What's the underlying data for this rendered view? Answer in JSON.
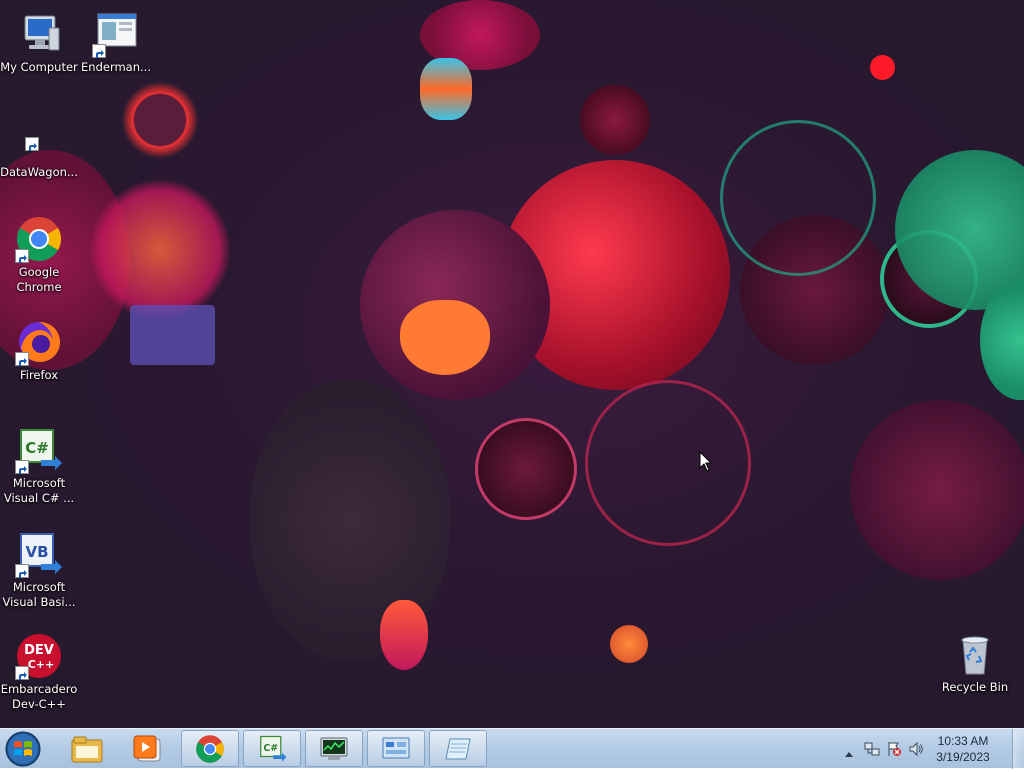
{
  "desktop": {
    "icons": [
      {
        "label": "My Computer",
        "icon": "computer-icon"
      },
      {
        "label": "Enderman...",
        "icon": "window-app-icon"
      },
      {
        "label": "DataWagon...",
        "icon": "blank-shortcut-icon"
      },
      {
        "label": "Google Chrome",
        "icon": "chrome-icon"
      },
      {
        "label": "Firefox",
        "icon": "firefox-icon"
      },
      {
        "label": "Microsoft Visual C# ...",
        "icon": "csharp-icon"
      },
      {
        "label": "Microsoft Visual Basi...",
        "icon": "vb-icon"
      },
      {
        "label": "Embarcadero Dev-C++",
        "icon": "devcpp-icon"
      },
      {
        "label": "Recycle Bin",
        "icon": "recycle-bin-icon"
      }
    ],
    "wallpaper_colors": [
      "#241a2c",
      "#c2185b",
      "#ff6f3c",
      "#26a69a",
      "#e91e63"
    ]
  },
  "taskbar": {
    "pinned": [
      {
        "icon": "file-explorer-icon"
      },
      {
        "icon": "media-player-icon"
      }
    ],
    "running": [
      {
        "icon": "chrome-icon"
      },
      {
        "icon": "csharp-icon"
      },
      {
        "icon": "task-manager-icon"
      },
      {
        "icon": "control-panel-icon"
      },
      {
        "icon": "notepad-icon"
      }
    ],
    "tray": {
      "icons": [
        "show-hidden-icons-arrow",
        "network-icon",
        "action-center-flag-icon",
        "volume-icon"
      ],
      "time": "10:33 AM",
      "date": "3/19/2023"
    }
  }
}
